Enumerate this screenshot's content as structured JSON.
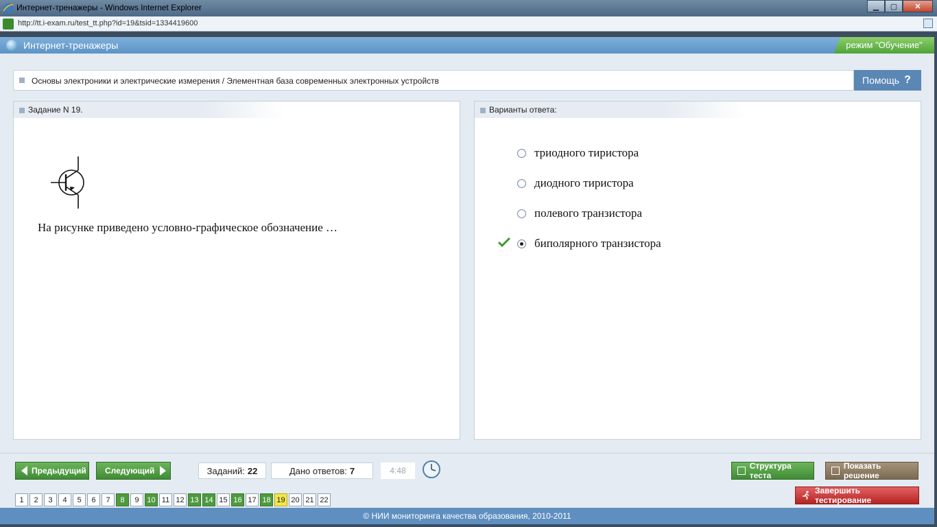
{
  "window": {
    "title": "Интернет-тренажеры - Windows Internet Explorer",
    "url": "http://tt.i-exam.ru/test_tt.php?id=19&tsid=1334419600",
    "buttons": [
      "minimize",
      "maximize",
      "close"
    ]
  },
  "header": {
    "app_title": "Интернет-тренажеры",
    "mode": "режим \"Обучение\""
  },
  "breadcrumb": {
    "text": "Основы электроники и электрические измерения / Элементная база современных электронных устройств",
    "help_label": "Помощь",
    "help_icon": "?"
  },
  "question": {
    "heading": "Задание N 19.",
    "symbol": "bipolar-transistor-icon",
    "text": "На рисунке приведено условно-графическое обозначение …"
  },
  "answers": {
    "heading": "Варианты ответа:",
    "options": [
      {
        "label": "триодного тиристора",
        "selected": false,
        "correct": false
      },
      {
        "label": "диодного тиристора",
        "selected": false,
        "correct": false
      },
      {
        "label": "полевого транзистора",
        "selected": false,
        "correct": false
      },
      {
        "label": "биполярного транзистора",
        "selected": true,
        "correct": true
      }
    ]
  },
  "nav": {
    "prev_label": "Предыдущий",
    "next_label": "Следующий",
    "tasks_label": "Заданий:",
    "tasks_value": "22",
    "answers_label": "Дано ответов:",
    "answers_value": "7",
    "timer": "4:48",
    "structure_label": "Структура теста",
    "solution_label": "Показать решение",
    "finish_label": "Завершить тестирование"
  },
  "pages": [
    {
      "n": "1",
      "state": "none"
    },
    {
      "n": "2",
      "state": "none"
    },
    {
      "n": "3",
      "state": "none"
    },
    {
      "n": "4",
      "state": "none"
    },
    {
      "n": "5",
      "state": "none"
    },
    {
      "n": "6",
      "state": "none"
    },
    {
      "n": "7",
      "state": "none"
    },
    {
      "n": "8",
      "state": "answered"
    },
    {
      "n": "9",
      "state": "none"
    },
    {
      "n": "10",
      "state": "answered"
    },
    {
      "n": "11",
      "state": "none"
    },
    {
      "n": "12",
      "state": "none"
    },
    {
      "n": "13",
      "state": "answered"
    },
    {
      "n": "14",
      "state": "answered"
    },
    {
      "n": "15",
      "state": "none"
    },
    {
      "n": "16",
      "state": "answered"
    },
    {
      "n": "17",
      "state": "none"
    },
    {
      "n": "18",
      "state": "answered"
    },
    {
      "n": "19",
      "state": "current"
    },
    {
      "n": "20",
      "state": "none"
    },
    {
      "n": "21",
      "state": "none"
    },
    {
      "n": "22",
      "state": "none"
    }
  ],
  "footer": "© НИИ мониторинга качества образования, 2010-2011",
  "colors": {
    "header_blue": "#5d93c6",
    "mode_green": "#4ea33a",
    "answered_green": "#4e9a3e",
    "current_yellow": "#f2e64d",
    "finish_red": "#b42424"
  }
}
